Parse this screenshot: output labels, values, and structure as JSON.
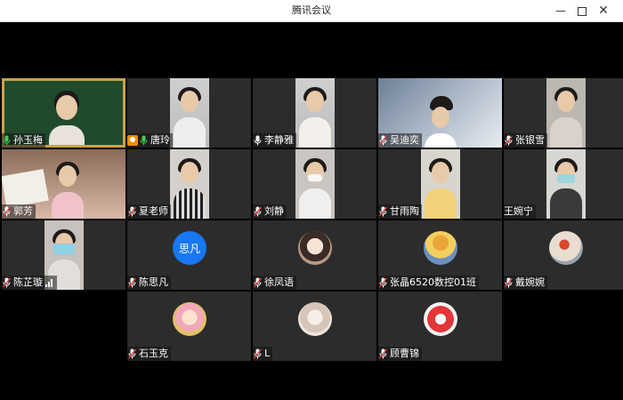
{
  "window": {
    "title": "腾讯会议",
    "minimize": "—",
    "close": "✕"
  },
  "participants": [
    {
      "name": "孙玉梅",
      "mic": "active",
      "kind": "video"
    },
    {
      "name": "唐玲",
      "mic": "active",
      "kind": "video",
      "host": true
    },
    {
      "name": "李静雅",
      "mic": "on",
      "kind": "video"
    },
    {
      "name": "吴迪奕",
      "mic": "muted",
      "kind": "video"
    },
    {
      "name": "张银雪",
      "mic": "muted",
      "kind": "video"
    },
    {
      "name": "郭芳",
      "mic": "muted",
      "kind": "video"
    },
    {
      "name": "夏老师",
      "mic": "muted",
      "kind": "video"
    },
    {
      "name": "刘静",
      "mic": "muted",
      "kind": "video"
    },
    {
      "name": "甘雨陶",
      "mic": "muted",
      "kind": "video"
    },
    {
      "name": "王婉宁",
      "mic": "none",
      "kind": "video"
    },
    {
      "name": "陈芷璇",
      "mic": "muted",
      "kind": "video",
      "signal": true
    },
    {
      "name": "陈思凡",
      "mic": "muted",
      "kind": "avatar-text",
      "avatar_text": "思凡"
    },
    {
      "name": "徐凤语",
      "mic": "muted",
      "kind": "avatar-img"
    },
    {
      "name": "张晶6520数控01班",
      "mic": "muted",
      "kind": "avatar-img"
    },
    {
      "name": "戴婉婉",
      "mic": "muted",
      "kind": "avatar-img"
    },
    {
      "name": "石玉克",
      "mic": "muted",
      "kind": "avatar-img"
    },
    {
      "name": "L",
      "mic": "muted",
      "kind": "avatar-img"
    },
    {
      "name": "顾曹锦",
      "mic": "muted",
      "kind": "avatar-img"
    }
  ],
  "colors": {
    "background": "#000000",
    "tile": "#2c2c2c",
    "mic_active": "#3fcf5a",
    "mic_muted": "#ffffff",
    "muted_slash": "#e03c3c",
    "avatar_blue": "#1877f2",
    "host_badge": "#f08c00"
  },
  "icons": {
    "mic": "microphone-icon",
    "muted": "microphone-muted-icon",
    "host": "host-badge-icon",
    "signal": "signal-bars-icon"
  }
}
